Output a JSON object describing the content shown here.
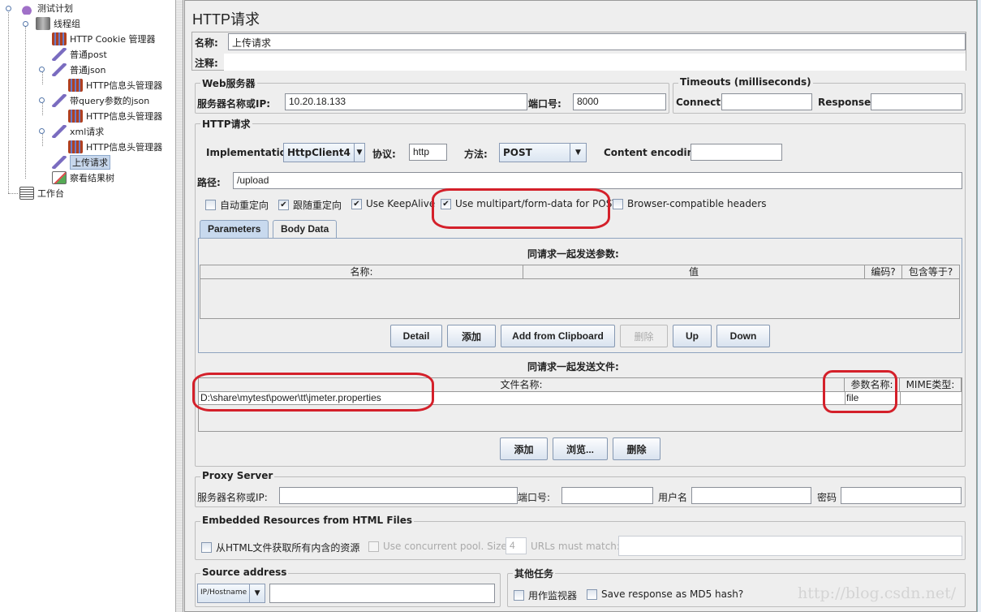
{
  "tree": {
    "items": [
      {
        "label": "测试计划",
        "icon": "flask-icon"
      },
      {
        "label": "线程组",
        "icon": "spool-icon"
      },
      {
        "label": "HTTP Cookie 管理器",
        "icon": "config-element-icon"
      },
      {
        "label": "普通post",
        "icon": "sampler-pipette-icon"
      },
      {
        "label": "普通json",
        "icon": "sampler-pipette-icon"
      },
      {
        "label": "HTTP信息头管理器",
        "icon": "config-element-icon"
      },
      {
        "label": "带query参数的json",
        "icon": "sampler-pipette-icon"
      },
      {
        "label": "HTTP信息头管理器",
        "icon": "config-element-icon"
      },
      {
        "label": "xml请求",
        "icon": "sampler-pipette-icon"
      },
      {
        "label": "HTTP信息头管理器",
        "icon": "config-element-icon"
      },
      {
        "label": "上传请求",
        "icon": "sampler-pipette-icon",
        "selected": true
      },
      {
        "label": "察看结果树",
        "icon": "listener-icon"
      },
      {
        "label": "工作台",
        "icon": "workbench-icon"
      }
    ]
  },
  "panel": {
    "title": "HTTP请求",
    "name_label": "名称:",
    "name_value": "上传请求",
    "comment_label": "注释:",
    "comment_value": ""
  },
  "web_server": {
    "title": "Web服务器",
    "server_label": "服务器名称或IP:",
    "server_value": "10.20.18.133",
    "port_label": "端口号:",
    "port_value": "8000"
  },
  "timeouts": {
    "title": "Timeouts (milliseconds)",
    "connect_label": "Connect:",
    "connect_value": "",
    "response_label": "Response:",
    "response_value": ""
  },
  "http_request": {
    "title": "HTTP请求",
    "implementation_label": "Implementation:",
    "implementation_value": "HttpClient4",
    "protocol_label": "协议:",
    "protocol_value": "http",
    "method_label": "方法:",
    "method_value": "POST",
    "encoding_label": "Content encoding:",
    "encoding_value": "",
    "path_label": "路径:",
    "path_value": "/upload",
    "checkboxes": [
      {
        "label": "自动重定向",
        "checked": false
      },
      {
        "label": "跟随重定向",
        "checked": true
      },
      {
        "label": "Use KeepAlive",
        "checked": true
      },
      {
        "label": "Use multipart/form-data for POST",
        "checked": true
      },
      {
        "label": "Browser-compatible headers",
        "checked": false
      }
    ]
  },
  "tabs": [
    {
      "label": "Parameters",
      "active": true
    },
    {
      "label": "Body Data",
      "active": false
    }
  ],
  "parameters": {
    "caption": "同请求一起发送参数:",
    "columns": [
      "名称:",
      "值",
      "编码?",
      "包含等于?"
    ],
    "rows": [],
    "buttons": [
      {
        "label": "Detail",
        "enabled": true
      },
      {
        "label": "添加",
        "enabled": true
      },
      {
        "label": "Add from Clipboard",
        "enabled": true
      },
      {
        "label": "删除",
        "enabled": false
      },
      {
        "label": "Up",
        "enabled": true
      },
      {
        "label": "Down",
        "enabled": true
      }
    ]
  },
  "files": {
    "caption": "同请求一起发送文件:",
    "columns": [
      "文件名称:",
      "参数名称:",
      "MIME类型:"
    ],
    "rows": [
      {
        "path": "D:\\share\\mytest\\power\\tt\\jmeter.properties",
        "param": "file",
        "mime": ""
      }
    ],
    "buttons": [
      {
        "label": "添加"
      },
      {
        "label": "浏览..."
      },
      {
        "label": "删除"
      }
    ]
  },
  "proxy": {
    "title": "Proxy Server",
    "server_label": "服务器名称或IP:",
    "port_label": "端口号:",
    "user_label": "用户名",
    "password_label": "密码",
    "server_value": "",
    "port_value": "",
    "user_value": "",
    "password_value": ""
  },
  "embedded": {
    "title": "Embedded Resources from HTML Files",
    "retrieve_label": "从HTML文件获取所有内含的资源",
    "pool_label": "Use concurrent pool. Size:",
    "pool_size": "4",
    "urls_label": "URLs must match:",
    "urls_value": ""
  },
  "source": {
    "title": "Source address",
    "type_value": "IP/Hostname",
    "address_value": ""
  },
  "other": {
    "title": "其他任务",
    "monitor_label": "用作监视器",
    "md5_label": "Save response as MD5 hash?"
  },
  "watermark": "http://blog.csdn.net/",
  "check_glyph": "✔",
  "arrow_glyph": "▼"
}
